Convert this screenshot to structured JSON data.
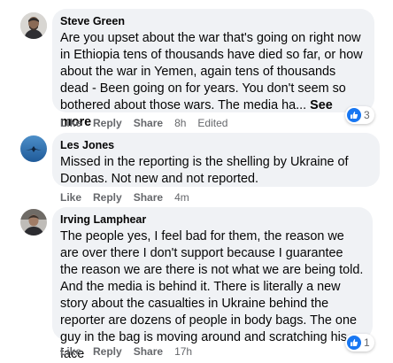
{
  "comments": [
    {
      "author": "Steve Green",
      "text": "Are you upset about the war that's going on right now in Ethiopia tens of thousands have died so far, or how about the war in Yemen, again tens of thousands dead - Been going on for years. You don't seem so bothered about those wars. The media ha...",
      "see_more": "See more",
      "actions": {
        "like": "Like",
        "reply": "Reply",
        "share": "Share",
        "time": "8h",
        "edited": "Edited"
      },
      "reaction_count": "3"
    },
    {
      "author": "Les Jones",
      "text": "Missed in the reporting is the shelling by Ukraine of Donbas. Not new and not reported.",
      "actions": {
        "like": "Like",
        "reply": "Reply",
        "share": "Share",
        "time": "4m"
      }
    },
    {
      "author": "Irving Lamphear",
      "text": "The people yes, I feel bad for them, the reason we are over there I don't support because I guarantee the reason we are there is not what we are being told. And the media is behind it. There is literally a new story about the casualties in Ukraine behind the reporter are dozens of people in body bags. The one guy in the bag is moving around and scratching his face",
      "actions": {
        "like": "Like",
        "reply": "Reply",
        "share": "Share",
        "time": "17h"
      },
      "reaction_count": "1"
    }
  ],
  "colors": {
    "bubble": "#f0f2f5",
    "meta": "#65676b",
    "like_blue": "#1877f2"
  },
  "icons": {
    "reaction": "thumbs-up-icon"
  }
}
